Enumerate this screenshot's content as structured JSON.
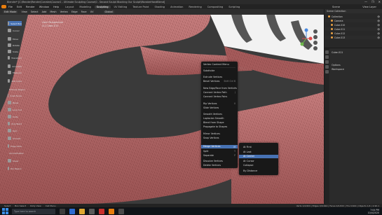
{
  "window": {
    "title": "Blender* [C:\\Render\\Render\\Corrales\\Course1 - Ultimate Sculpting Course\\0 - Second Sculpt Blocking Our Sculpt\\MonsterHandBlend]",
    "controls": [
      "—",
      "❐",
      "✕"
    ]
  },
  "menubar": {
    "items": [
      "File",
      "Edit",
      "Render",
      "Window",
      "Help"
    ],
    "workspaces": [
      "Layout",
      "Modeling",
      "Sculpting",
      "UV Editing",
      "Texture Paint",
      "Shading",
      "Animation",
      "Rendering",
      "Compositing",
      "Scripting"
    ],
    "active_workspace": "Sculpting",
    "scene": "Scene",
    "view_layer": "View Layer"
  },
  "header": {
    "mode": "Edit Mode",
    "items": [
      "View",
      "Select",
      "Add",
      "Mesh",
      "Vertex",
      "Edge",
      "Face",
      "UV"
    ],
    "transform": "Global"
  },
  "viewport": {
    "info_line1": "User Perspective",
    "info_line2": "(1) Cube.011",
    "mesh_color": "#b76a6a",
    "wire_color": "#5a2222"
  },
  "toolbar": {
    "items": [
      {
        "label": "Select Box",
        "active": true
      },
      {
        "label": "Cursor",
        "active": false
      },
      {
        "label": "Move",
        "active": false
      },
      {
        "label": "Rotate",
        "active": false
      },
      {
        "label": "Scale",
        "active": false
      },
      {
        "label": "Transform",
        "active": false
      },
      {
        "label": "Annotate",
        "active": false
      },
      {
        "label": "Measure",
        "active": false
      },
      {
        "label": "Add Cube",
        "active": false
      },
      {
        "label": "Extrude Region",
        "active": false
      },
      {
        "label": "Inset Faces",
        "active": false
      },
      {
        "label": "Bevel",
        "active": false
      },
      {
        "label": "Loop Cut",
        "active": false
      },
      {
        "label": "Knife",
        "active": false
      },
      {
        "label": "Poly Build",
        "active": false
      },
      {
        "label": "Spin",
        "active": false
      },
      {
        "label": "Smooth",
        "active": false
      },
      {
        "label": "Edge Slide",
        "active": false
      },
      {
        "label": "Shrink/Flatten",
        "active": false
      },
      {
        "label": "Shear",
        "active": false
      },
      {
        "label": "Rip Region",
        "active": false
      }
    ]
  },
  "context_menu": {
    "title": "Vertex Context Menu",
    "items": [
      {
        "label": "Subdivide",
        "shortcut": ""
      },
      {
        "label": "Extrude Vertices",
        "shortcut": ""
      },
      {
        "label": "Bevel Vertices",
        "shortcut": "Shift Ctrl B"
      },
      {
        "label": "New Edge/Face from Vertices",
        "shortcut": "F"
      },
      {
        "label": "Connect Vertex Path",
        "shortcut": "J"
      },
      {
        "label": "Connect Vertex Pairs",
        "shortcut": ""
      },
      {
        "label": "Rip Vertices",
        "shortcut": "V"
      },
      {
        "label": "Slide Vertices",
        "shortcut": ""
      },
      {
        "label": "Smooth Vertices",
        "shortcut": ""
      },
      {
        "label": "Laplacian Smooth",
        "shortcut": ""
      },
      {
        "label": "Blend from Shape",
        "shortcut": ""
      },
      {
        "label": "Propagate to Shapes",
        "shortcut": ""
      },
      {
        "label": "Mirror Vertices",
        "shortcut": ""
      },
      {
        "label": "Snap Vertices",
        "shortcut": ""
      },
      {
        "label": "Merge Vertices",
        "shortcut": "M"
      },
      {
        "label": "Split",
        "shortcut": "Y"
      },
      {
        "label": "Separate",
        "shortcut": "P"
      },
      {
        "label": "Dissolve Vertices",
        "shortcut": ""
      },
      {
        "label": "Delete Vertices",
        "shortcut": ""
      }
    ],
    "highlighted": "Merge Vertices"
  },
  "submenu": {
    "items": [
      "At First",
      "At Last",
      "At Center",
      "At Cursor",
      "Collapse",
      "By Distance"
    ],
    "highlighted": "At Center"
  },
  "outliner": {
    "header": "Scene Collection",
    "rows": [
      "Collection",
      "Camera",
      "Cube.010",
      "Cube.011",
      "Cube.012",
      "Cube.013"
    ]
  },
  "properties": {
    "object": "Cube.011",
    "sections": [
      "Options",
      "Workspace"
    ]
  },
  "statusbar": {
    "left_items": [
      "Select",
      "Box Select",
      "Dolly View",
      "Call Menu"
    ],
    "right": "Verts 1/4,824 | Edges 0/9,644 | Faces 0/4,822 | Tris 9,644 | Objects 1/4 | 2.90.1"
  },
  "taskbar": {
    "search": "Type here to search",
    "time": "7:04 PM",
    "date": "10/4/2020"
  },
  "colors": {
    "accent": "#4772b3",
    "blender_orange": "#e87d0d",
    "background": "#3a3a3a"
  }
}
